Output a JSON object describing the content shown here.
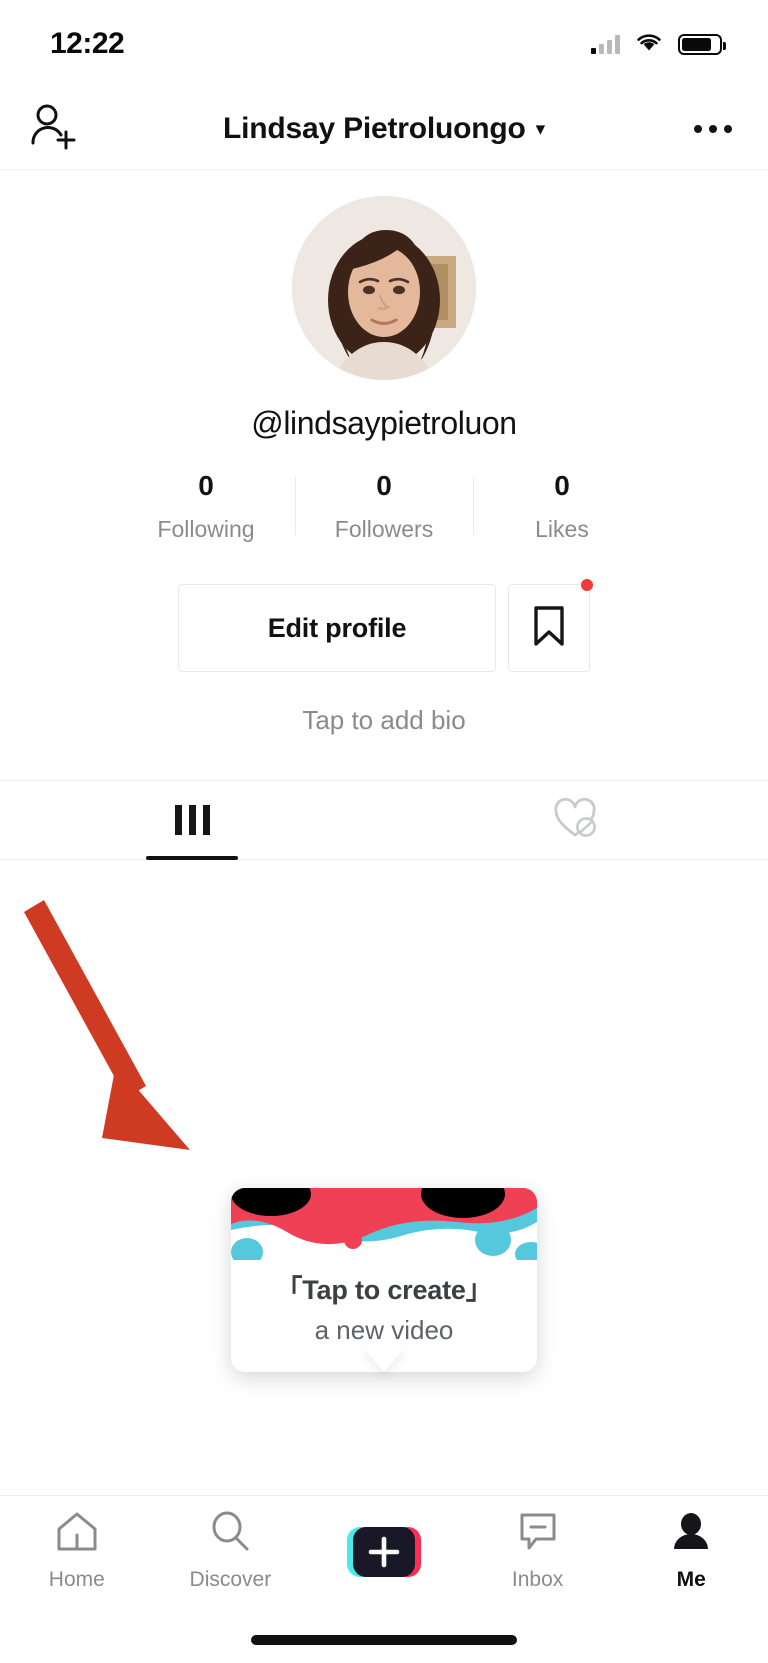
{
  "status_bar": {
    "time": "12:22",
    "signal_icon": "cellular-signal-icon",
    "wifi_icon": "wifi-icon",
    "battery_icon": "battery-icon"
  },
  "header": {
    "add_friend_icon": "add-user-icon",
    "title": "Lindsay Pietroluongo",
    "caret": "▾",
    "more_icon": "more-options-icon"
  },
  "profile": {
    "avatar_alt": "profile-photo",
    "username": "@lindsaypietroluon",
    "bio_placeholder": "Tap to add bio",
    "stats": [
      {
        "value": "0",
        "label": "Following"
      },
      {
        "value": "0",
        "label": "Followers"
      },
      {
        "value": "0",
        "label": "Likes"
      }
    ],
    "edit_profile_label": "Edit profile",
    "bookmark_icon": "bookmark-icon",
    "bookmark_badge": true
  },
  "tabs": [
    {
      "icon": "grid-posts-icon",
      "active": true
    },
    {
      "icon": "private-liked-heart-icon",
      "active": false
    }
  ],
  "annotation": {
    "arrow_icon": "red-arrow-annotation",
    "color": "#cf3a22"
  },
  "tooltip": {
    "line1": "「Tap to create」",
    "line2": "a new video",
    "art_colors": {
      "cyan": "#56c8dd",
      "red": "#ef4056",
      "black": "#000000"
    }
  },
  "bottom_nav": {
    "items": [
      {
        "label": "Home",
        "icon": "home-icon",
        "active": false
      },
      {
        "label": "Discover",
        "icon": "search-icon",
        "active": false
      },
      {
        "label": "",
        "icon": "create-plus-icon",
        "active": false
      },
      {
        "label": "Inbox",
        "icon": "inbox-message-icon",
        "active": false
      },
      {
        "label": "Me",
        "icon": "person-icon",
        "active": true
      }
    ],
    "create_colors": {
      "left": "#4de8ec",
      "right": "#ff2c55",
      "center": "#181826"
    }
  }
}
